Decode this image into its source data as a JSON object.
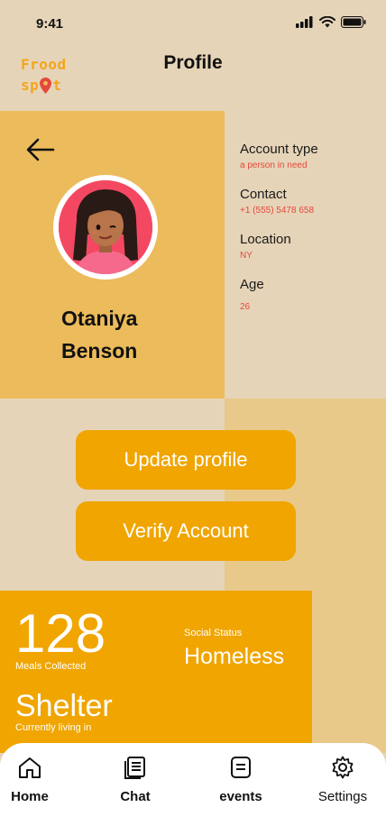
{
  "status": {
    "time": "9:41"
  },
  "header": {
    "logo_line1": "Frood",
    "logo_line2_a": "sp",
    "logo_line2_b": "t",
    "title": "Profile"
  },
  "profile": {
    "first_name": "Otaniya",
    "last_name": "Benson"
  },
  "info": [
    {
      "label": "Account type",
      "value": "a person in need"
    },
    {
      "label": "Contact",
      "value": "+1 (555) 5478 658"
    },
    {
      "label": "Location",
      "value": "NY"
    },
    {
      "label": "Age",
      "value": "26"
    }
  ],
  "buttons": {
    "update": "Update profile",
    "verify": "Verify Account"
  },
  "stats": {
    "meals_value": "128",
    "meals_label": "Meals Collected",
    "social_label": "Social Status",
    "social_value": "Homeless",
    "shelter_value": "Shelter",
    "shelter_label": "Currently living in"
  },
  "nav": [
    {
      "label": "Home",
      "icon": "home-icon"
    },
    {
      "label": "Chat",
      "icon": "document-icon"
    },
    {
      "label": "events",
      "icon": "events-icon"
    },
    {
      "label": "Settings",
      "icon": "gear-icon"
    }
  ],
  "colors": {
    "accent": "#f0a500",
    "card": "#ecbb5b",
    "background": "#e6d4b8",
    "value_red": "#e5483c"
  }
}
